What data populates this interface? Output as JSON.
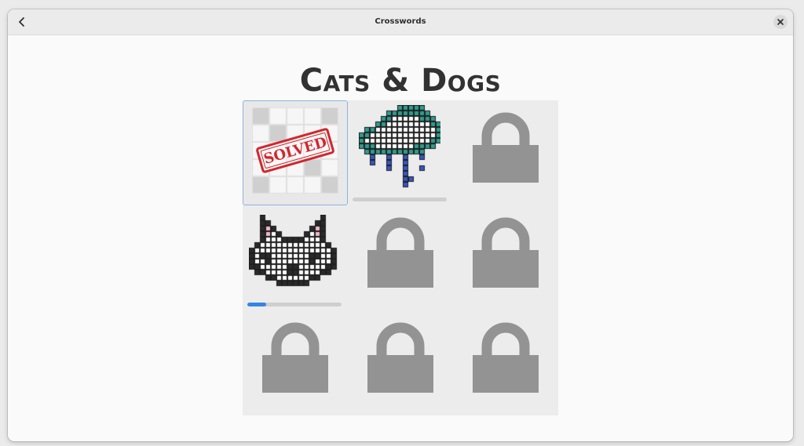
{
  "window": {
    "title": "Crosswords"
  },
  "puzzle_set": {
    "title": "Cats & Dogs"
  },
  "icons": {
    "back": "chevron-left-icon",
    "close": "close-icon",
    "lock": "lock-icon"
  },
  "colors": {
    "accent": "#3584e4",
    "selection_border": "#8db3e2",
    "stamp_red": "#d2262d",
    "lock_gray": "#939393",
    "teal": "#2f9c8e",
    "blue": "#3556c8"
  },
  "tiles": [
    {
      "index": 1,
      "status": "solved",
      "stamp_text": "SOLVED",
      "selected": true
    },
    {
      "index": 2,
      "status": "in-progress",
      "artwork": "rain-cloud",
      "progress": 0.0
    },
    {
      "index": 3,
      "status": "locked"
    },
    {
      "index": 4,
      "status": "in-progress",
      "artwork": "cat-face",
      "progress": 0.2
    },
    {
      "index": 5,
      "status": "locked"
    },
    {
      "index": 6,
      "status": "locked"
    },
    {
      "index": 7,
      "status": "locked"
    },
    {
      "index": 8,
      "status": "locked"
    },
    {
      "index": 9,
      "status": "locked"
    }
  ]
}
